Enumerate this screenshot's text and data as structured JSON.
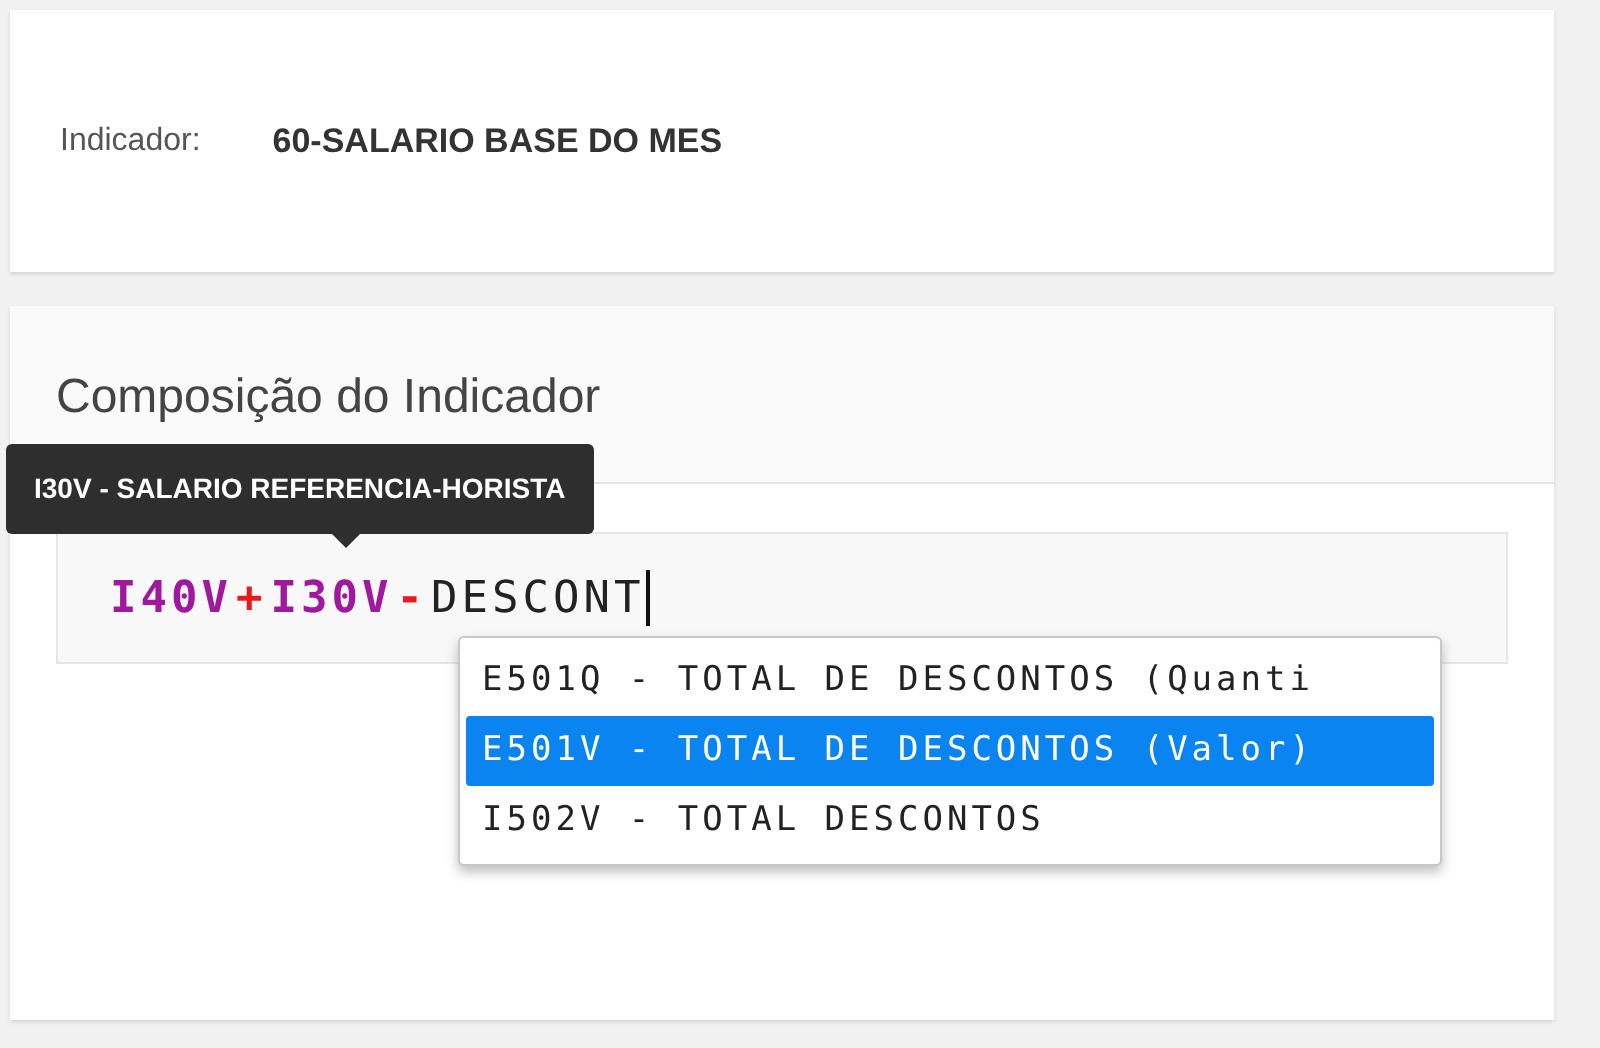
{
  "indicator": {
    "label": "Indicador:",
    "value": "60-SALARIO BASE DO MES"
  },
  "composition": {
    "title": "Composição do Indicador",
    "tooltip": "I30V - SALARIO REFERENCIA-HORISTA",
    "formula": [
      {
        "kind": "variable",
        "text": "I40V"
      },
      {
        "kind": "operator",
        "text": "+"
      },
      {
        "kind": "variable",
        "text": "I30V"
      },
      {
        "kind": "operator",
        "text": "-"
      },
      {
        "kind": "text",
        "text": "DESCONT"
      }
    ],
    "suggestions": [
      {
        "text": "E501Q - TOTAL DE DESCONTOS (Quanti",
        "selected": false
      },
      {
        "text": "E501V - TOTAL DE DESCONTOS (Valor)",
        "selected": true
      },
      {
        "text": "I502V - TOTAL DESCONTOS",
        "selected": false
      }
    ]
  }
}
